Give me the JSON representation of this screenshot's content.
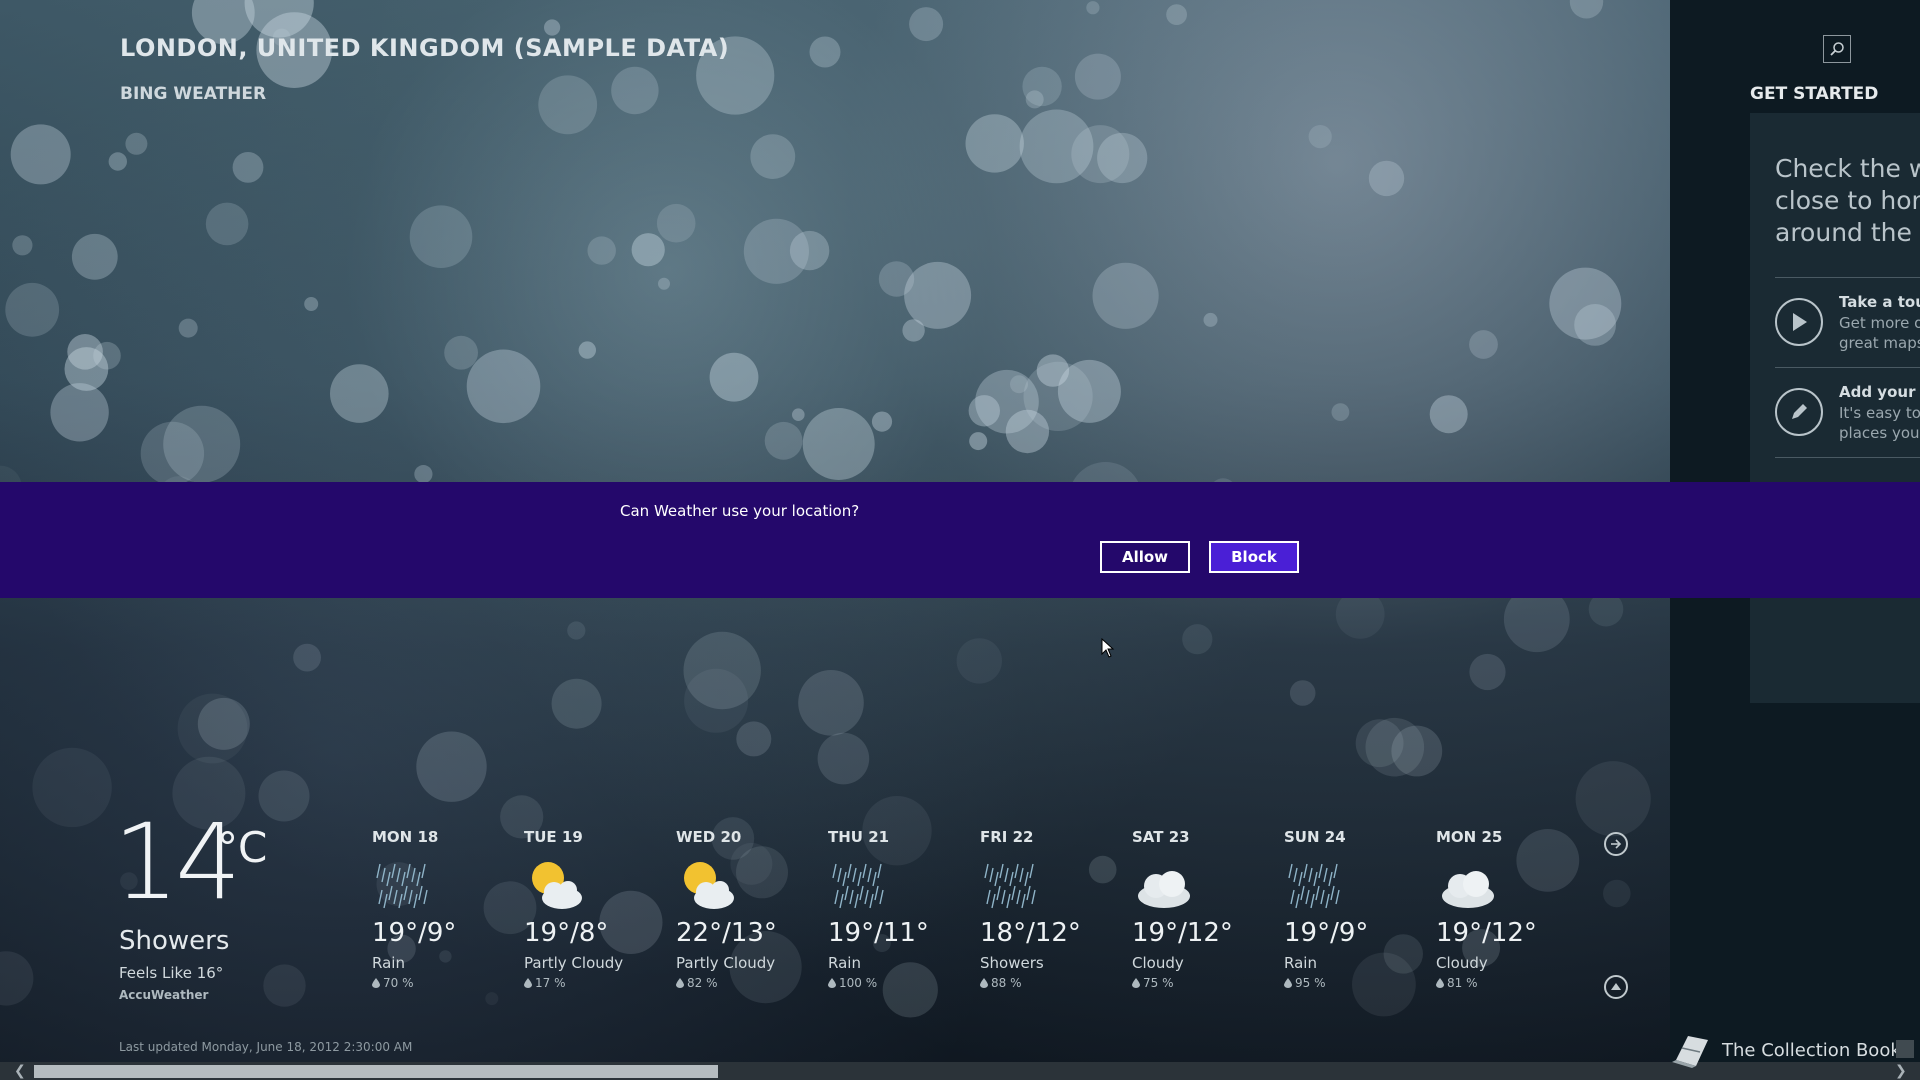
{
  "header": {
    "location": "LONDON, UNITED KINGDOM (SAMPLE DATA)",
    "app_name": "BING WEATHER"
  },
  "side_panel": {
    "heading": "GET STARTED",
    "intro": "Check the weather close to home and around the world.",
    "items": [
      {
        "title": "Take a tour",
        "desc": "Get more out of Weather with great maps",
        "icon": "play-icon"
      },
      {
        "title": "Add your favorites",
        "desc": "It's easy to find the weather for places you care about",
        "icon": "pencil-icon"
      }
    ]
  },
  "permission": {
    "question": "Can Weather use your location?",
    "allow_label": "Allow",
    "block_label": "Block"
  },
  "current": {
    "temp": "14",
    "unit": "°C",
    "condition": "Showers",
    "feels_like": "Feels Like 16°",
    "provider": "AccuWeather",
    "last_updated": "Last updated Monday, June 18, 2012 2:30:00 AM"
  },
  "forecast": [
    {
      "day": "MON 18",
      "temp": "19°/9°",
      "condition": "Rain",
      "precip": "70 %",
      "icon": "rain-icon"
    },
    {
      "day": "TUE 19",
      "temp": "19°/8°",
      "condition": "Partly Cloudy",
      "precip": "17 %",
      "icon": "partly-cloudy-icon"
    },
    {
      "day": "WED 20",
      "temp": "22°/13°",
      "condition": "Partly Cloudy",
      "precip": "82 %",
      "icon": "partly-cloudy-icon"
    },
    {
      "day": "THU 21",
      "temp": "19°/11°",
      "condition": "Rain",
      "precip": "100 %",
      "icon": "rain-icon"
    },
    {
      "day": "FRI 22",
      "temp": "18°/12°",
      "condition": "Showers",
      "precip": "88 %",
      "icon": "rain-icon"
    },
    {
      "day": "SAT 23",
      "temp": "19°/12°",
      "condition": "Cloudy",
      "precip": "75 %",
      "icon": "cloudy-icon"
    },
    {
      "day": "SUN 24",
      "temp": "19°/9°",
      "condition": "Rain",
      "precip": "95 %",
      "icon": "rain-icon"
    },
    {
      "day": "MON 25",
      "temp": "19°/12°",
      "condition": "Cloudy",
      "precip": "81 %",
      "icon": "cloudy-icon"
    }
  ],
  "taskbar": {
    "label": "The Collection Book"
  },
  "colors": {
    "banner": "#24086b",
    "block_button": "#4a1fd6"
  }
}
